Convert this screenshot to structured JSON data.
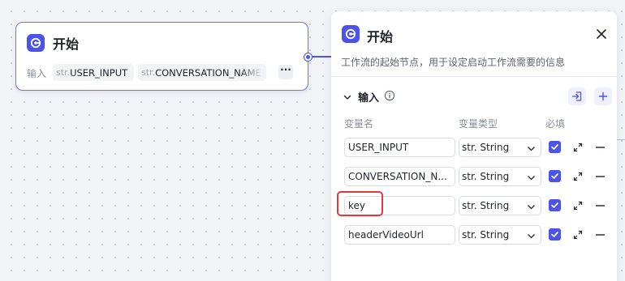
{
  "node": {
    "title": "开始",
    "input_label": "输入",
    "tags": [
      {
        "type": "str.",
        "name": "USER_INPUT"
      },
      {
        "type": "str.",
        "name": "CONVERSATION_NAME"
      }
    ],
    "more_label": "···"
  },
  "panel": {
    "title": "开始",
    "description": "工作流的起始节点，用于设定启动工作流需要的信息",
    "section_title": "输入",
    "columns": {
      "name": "变量名",
      "type": "变量类型",
      "required": "必填"
    },
    "rows": [
      {
        "name": "USER_INPUT",
        "type": "str. String",
        "required": true
      },
      {
        "name": "CONVERSATION_N...",
        "type": "str. String",
        "required": true
      },
      {
        "name": "key",
        "type": "str. String",
        "required": true
      },
      {
        "name": "headerVideoUrl",
        "type": "str. String",
        "required": true
      }
    ]
  },
  "icons": {
    "node_icon": "start-icon",
    "close": "close-icon",
    "chevron": "chevron-down-icon",
    "info": "info-icon",
    "import": "import-icon",
    "add": "plus-icon",
    "expand": "expand-icon",
    "remove": "minus-icon",
    "check": "check-icon"
  },
  "colors": {
    "accent": "#4d53e8",
    "highlight": "#e5383b",
    "canvas": "#f2f3f6"
  }
}
